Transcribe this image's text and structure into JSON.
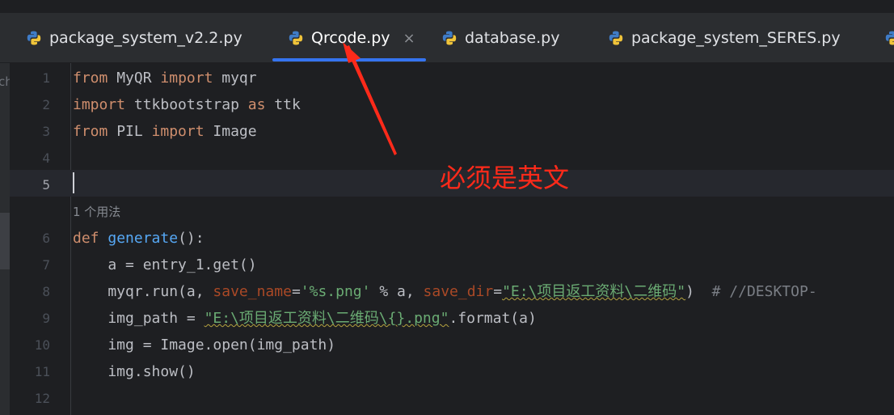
{
  "tabs": [
    {
      "label": "package_system_v2.2.py",
      "icon": "python-file-icon"
    },
    {
      "label": "Qrcode.py",
      "icon": "python-file-icon",
      "active": true,
      "close": "×"
    },
    {
      "label": "database.py",
      "icon": "python-file-icon"
    },
    {
      "label": "package_system_SERES.py",
      "icon": "python-file-icon"
    }
  ],
  "left_fragment": "ch",
  "line_numbers": [
    "1",
    "2",
    "3",
    "4",
    "5",
    "6",
    "7",
    "8",
    "9",
    "10",
    "11",
    "12"
  ],
  "current_line": "5",
  "usage_hint": "1 个用法",
  "code": {
    "l1": {
      "kw1": "from",
      "t1": " MyQR ",
      "kw2": "import",
      "t2": " myqr"
    },
    "l2": {
      "kw1": "import",
      "t1": " ttkbootstrap ",
      "kw2": "as",
      "t2": " ttk"
    },
    "l3": {
      "kw1": "from",
      "t1": " PIL ",
      "kw2": "import",
      "t2": " Image"
    },
    "l6": {
      "kw1": "def",
      "sp": " ",
      "fn": "generate",
      "t1": "():"
    },
    "l7": {
      "t1": "    a = entry_1.get()"
    },
    "l8": {
      "t1": "    myqr.run(a, ",
      "p1": "save_name",
      "eq1": "=",
      "s1": "'%s.png'",
      "t2": " % a, ",
      "p2": "save_dir",
      "eq2": "=",
      "s2": "\"E:\\项目返工资料\\二维码\"",
      "t3": ")  ",
      "cmt": "# //DESKTOP-"
    },
    "l9": {
      "t1": "    img_path = ",
      "s1": "\"E:\\项目返工资料\\二维码\\{}.png\"",
      "t2": ".format(a)"
    },
    "l10": {
      "t1": "    img = Image.open(img_path)"
    },
    "l11": {
      "t1": "    img.show()"
    }
  },
  "annotation_text": "必须是英文",
  "colors": {
    "keyword": "#cf8e6d",
    "function": "#56a8f5",
    "string": "#6aab73",
    "param": "#aa4926",
    "accent": "#3574f0",
    "annotation": "#ff2a1a"
  }
}
